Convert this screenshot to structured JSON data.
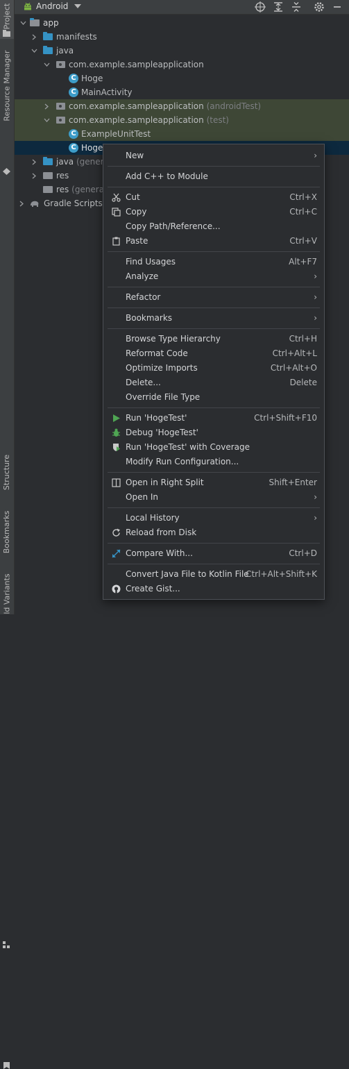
{
  "side_strip": {
    "project": "Project",
    "resource_manager": "Resource Manager",
    "structure": "Structure",
    "bookmarks": "Bookmarks",
    "build_variants": "ld Variants"
  },
  "header": {
    "view_mode": "Android",
    "icons": [
      "android-icon",
      "chevron-down-icon",
      "target-icon",
      "expand-all-icon",
      "collapse-all-icon",
      "gear-icon",
      "minimize-icon"
    ]
  },
  "tree": {
    "app": "app",
    "manifests": "manifests",
    "java": "java",
    "pkg_main": "com.example.sampleapplication",
    "hoge": "Hoge",
    "main_activity": "MainActivity",
    "pkg_android_test": "com.example.sampleapplication",
    "pkg_android_test_suffix": "(androidTest)",
    "pkg_test": "com.example.sampleapplication",
    "pkg_test_suffix": "(test)",
    "example_unit_test": "ExampleUnitTest",
    "hoge_test": "HogeTest",
    "java_generated": "java",
    "java_generated_suffix": "(generated)",
    "res": "res",
    "res_generated": "res",
    "res_generated_suffix": "(generated)",
    "gradle_scripts": "Gradle Scripts"
  },
  "menu": {
    "new": "New",
    "add_cpp": "Add C++ to Module",
    "cut": "Cut",
    "cut_sc": "Ctrl+X",
    "copy": "Copy",
    "copy_sc": "Ctrl+C",
    "copy_path": "Copy Path/Reference...",
    "paste": "Paste",
    "paste_sc": "Ctrl+V",
    "find_usages": "Find Usages",
    "find_usages_sc": "Alt+F7",
    "analyze": "Analyze",
    "refactor": "Refactor",
    "bookmarks": "Bookmarks",
    "browse_hierarchy": "Browse Type Hierarchy",
    "browse_hierarchy_sc": "Ctrl+H",
    "reformat": "Reformat Code",
    "reformat_sc": "Ctrl+Alt+L",
    "optimize": "Optimize Imports",
    "optimize_sc": "Ctrl+Alt+O",
    "delete": "Delete...",
    "delete_sc": "Delete",
    "override": "Override File Type",
    "run": "Run 'HogeTest'",
    "run_sc": "Ctrl+Shift+F10",
    "debug": "Debug 'HogeTest'",
    "coverage": "Run 'HogeTest' with Coverage",
    "modify_run": "Modify Run Configuration...",
    "open_split": "Open in Right Split",
    "open_split_sc": "Shift+Enter",
    "open_in": "Open In",
    "local_history": "Local History",
    "reload": "Reload from Disk",
    "compare": "Compare With...",
    "compare_sc": "Ctrl+D",
    "convert": "Convert Java File to Kotlin File",
    "convert_sc": "Ctrl+Alt+Shift+K",
    "gist": "Create Gist..."
  },
  "colors": {
    "background": "#2b2d30",
    "selection": "#0d293e",
    "test_highlight": "#3e4736",
    "accent_blue": "#3592c4",
    "run_green": "#4fa553"
  }
}
